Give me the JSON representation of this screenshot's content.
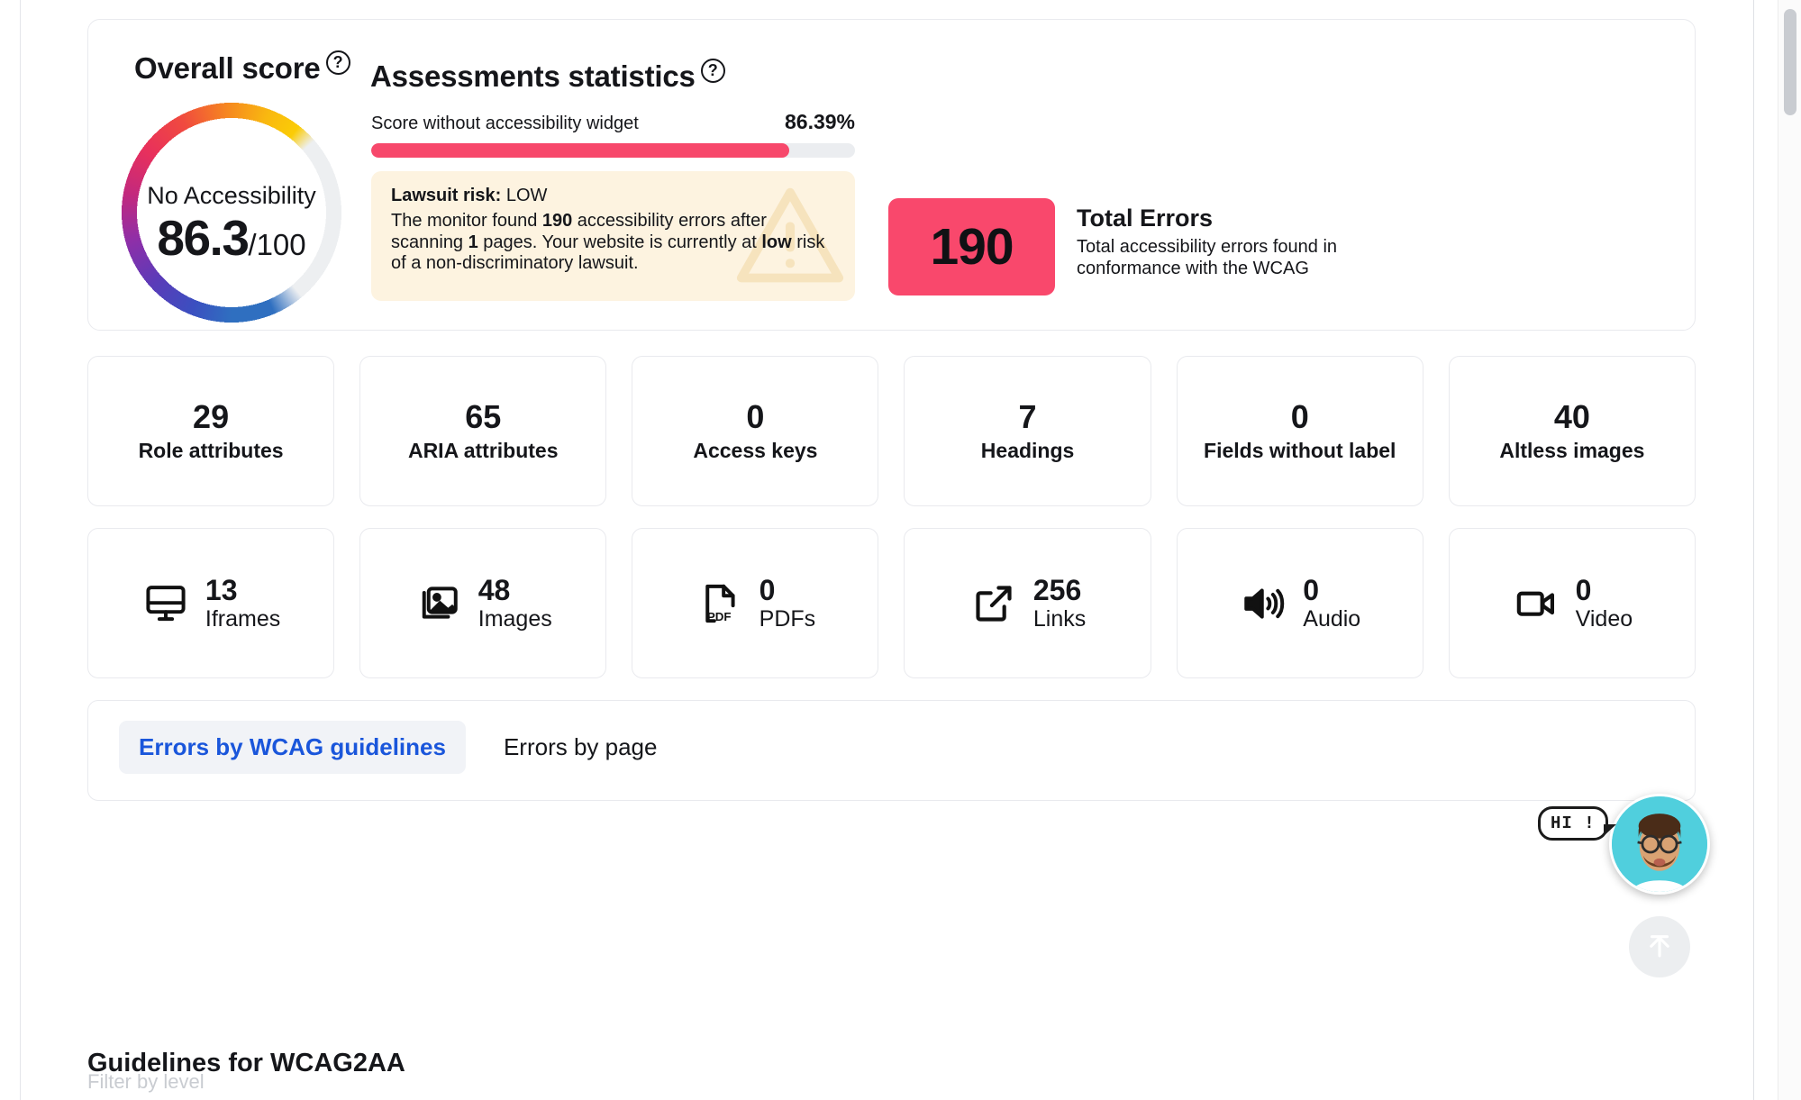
{
  "overall": {
    "title": "Overall score",
    "help_icon": "question-mark-icon",
    "gauge_label": "No Accessibility",
    "score": "86.3",
    "score_suffix": "/100",
    "gauge_percent": 86.3
  },
  "assessments": {
    "title": "Assessments statistics",
    "help_icon": "question-mark-icon",
    "score_bar": {
      "label": "Score without accessibility widget",
      "value": "86.39%",
      "percent": 86.39
    },
    "lawsuit": {
      "risk_title": "Lawsuit risk:",
      "risk_level": "LOW",
      "body_1": "The monitor found ",
      "errors_count": "190",
      "body_2": " accessibility errors after scanning ",
      "pages_count": "1",
      "body_3": " pages. Your website is currently at ",
      "risk_word": "low",
      "body_4": " risk of a non-discriminatory lawsuit.",
      "watermark_icon": "warning-triangle-icon"
    },
    "total_errors": {
      "count": "190",
      "title": "Total Errors",
      "description": "Total accessibility errors found in conformance with the WCAG"
    }
  },
  "stats_row_1": [
    {
      "value": "29",
      "label": "Role attributes"
    },
    {
      "value": "65",
      "label": "ARIA attributes"
    },
    {
      "value": "0",
      "label": "Access keys"
    },
    {
      "value": "7",
      "label": "Headings"
    },
    {
      "value": "0",
      "label": "Fields without label"
    },
    {
      "value": "40",
      "label": "Altless images"
    }
  ],
  "stats_row_2": [
    {
      "value": "13",
      "label": "Iframes",
      "icon": "monitor-icon"
    },
    {
      "value": "48",
      "label": "Images",
      "icon": "image-icon"
    },
    {
      "value": "0",
      "label": "PDFs",
      "icon": "pdf-file-icon"
    },
    {
      "value": "256",
      "label": "Links",
      "icon": "external-link-icon"
    },
    {
      "value": "0",
      "label": "Audio",
      "icon": "speaker-icon"
    },
    {
      "value": "0",
      "label": "Video",
      "icon": "video-camera-icon"
    }
  ],
  "tabs": [
    {
      "label": "Errors by WCAG guidelines",
      "active": true
    },
    {
      "label": "Errors by page",
      "active": false
    }
  ],
  "bottom": {
    "heading": "Guidelines for WCAG2AA",
    "subtext": "Filter by level"
  },
  "chat": {
    "bubble_text": "HI !",
    "avatar_icon": "chat-avatar-icon"
  },
  "scroll_top": {
    "icon": "arrow-up-icon"
  },
  "colors": {
    "accent_pink": "#f9486c",
    "bar_fill": "#f7486b",
    "bar_track": "#ebedf0",
    "lawsuit_bg": "#fdf3e0",
    "tab_active_text": "#1a56db",
    "tab_active_bg": "#f1f3f7",
    "chat_ring": "#50cfdd"
  }
}
